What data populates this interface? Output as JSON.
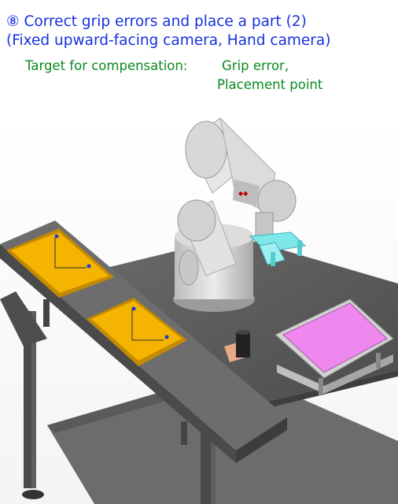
{
  "header": {
    "title": "⑧ Correct grip errors and place a part (2)",
    "subtitle": "(Fixed upward-facing camera, Hand camera)",
    "target_label": "Target for compensation:",
    "target_value_line1": "Grip error,",
    "target_value_line2": "Placement point"
  },
  "colors": {
    "title": "#1530e0",
    "target_text": "#0b8a1f",
    "tray": "#f5b400",
    "placement_pad": "#ee88ee",
    "camera_bracket": "#7ee8e8",
    "robot": "#d6d6d6",
    "table": "#555555"
  },
  "scene": {
    "description_icons": [
      "robot-arm-icon",
      "tray-icon",
      "placement-table-icon",
      "fixed-camera-icon",
      "hand-camera-icon"
    ]
  }
}
